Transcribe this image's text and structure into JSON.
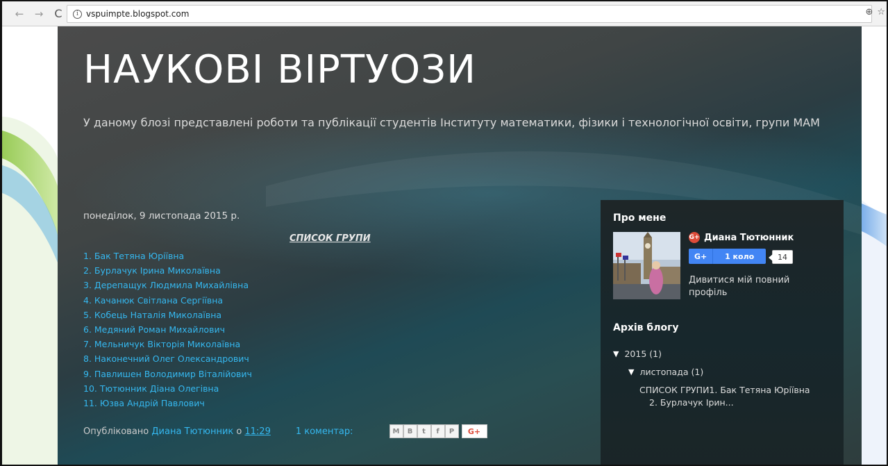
{
  "browser": {
    "back": "←",
    "forward": "→",
    "reload": "C",
    "url": "vspuimpte.blogspot.com",
    "zoom_icon": "⊕",
    "star_icon": "☆"
  },
  "blog": {
    "title": "НАУКОВІ ВІРТУОЗИ",
    "description": "У даному блозі представлені роботи та публікації студентів Інституту математики, фізики і технологічної освіти, групи МАМ"
  },
  "post": {
    "date": "понеділок, 9 листопада 2015 р.",
    "heading": "СПИСОК ГРУПИ",
    "members": [
      "1. Бак Тетяна Юріївна",
      "2. Бурлачук Ірина Миколаївна",
      "3. Дерепащук Людмила Михайлівна",
      "4. Качанюк Світлана Сергіївна",
      "5. Кобець Наталія Миколаївна",
      "6. Медяний Роман Михайлович",
      "7. Мельничук Вікторія Миколаївна",
      "8. Наконечний Олег Олександрович",
      "9. Павлишен Володимир Віталійович",
      "10. Тютюнник Діана Олегівна",
      "11. Юзва Андрій Павлович"
    ],
    "footer_prefix": "Опубліковано",
    "author": "Диана Тютюнник",
    "at": "о",
    "time": "11:29",
    "comments": "1 коментар:",
    "share": [
      "M",
      "B",
      "t",
      "f",
      "P"
    ],
    "gplus": "G+"
  },
  "sidebar": {
    "about_title": "Про мене",
    "profile_name": "Диана Тютюнник",
    "gp_badge": "G+",
    "circle_g": "G+",
    "circle_label": "1 коло",
    "circle_count": "14",
    "profile_link": "Дивитися мій повний профіль",
    "archive_title": "Архів блогу",
    "archive_year": "2015 (1)",
    "archive_month": "листопада (1)",
    "archive_post_line1": "СПИСОК ГРУПИ1. Бак Тетяна Юріївна",
    "archive_post_line2": "2. Бурлачук Ірин...",
    "triangle": "▼"
  },
  "colors": {
    "link": "#35b8f0",
    "gplus_red": "#dd4b39",
    "gplus_blue": "#4285f4"
  }
}
